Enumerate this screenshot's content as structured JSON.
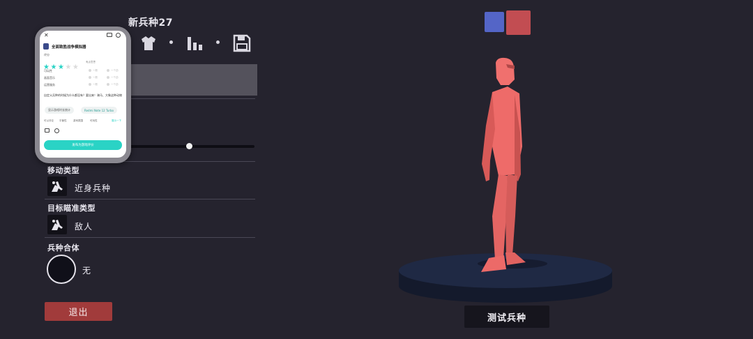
{
  "editor": {
    "unit_name": "新兵种27",
    "team_colors": [
      "#5465c7",
      "#c24d52"
    ],
    "movement_type_label": "移动类型",
    "movement_type_value": "近身兵种",
    "target_type_label": "目标瞄准类型",
    "target_type_value": "敌人",
    "combine_label": "兵种合体",
    "combine_value": "无",
    "exit_label": "退出",
    "test_label": "测试兵种"
  },
  "phone_overlay": {
    "app_title": "全面致胜战争模拟器",
    "rating_label": "评分",
    "rating_value": 3,
    "rating_max": 5,
    "rating_hint": "有点意思",
    "criteria": [
      {
        "label": "可玩性",
        "opt_a": "一般",
        "opt_b": "一个劲"
      },
      {
        "label": "画面音乐",
        "opt_a": "一般",
        "opt_b": "一个劲"
      },
      {
        "label": "运营服务",
        "opt_a": "一般",
        "opt_b": "一个劲"
      }
    ],
    "question": "自定义兵种的时候为什么都没有？要出来！骑马、大象这种动物",
    "chip_a": "显示游戏时长统计",
    "chip_b": "Redmi Note 12 Turbo",
    "meta_label": "可以评论",
    "meta_items": [
      "平衡性",
      "游戏氛围",
      "可玩性"
    ],
    "meta_link": "展示一下",
    "publish_label": "发布为游戏评价",
    "accent_color": "#2ad3c5"
  }
}
